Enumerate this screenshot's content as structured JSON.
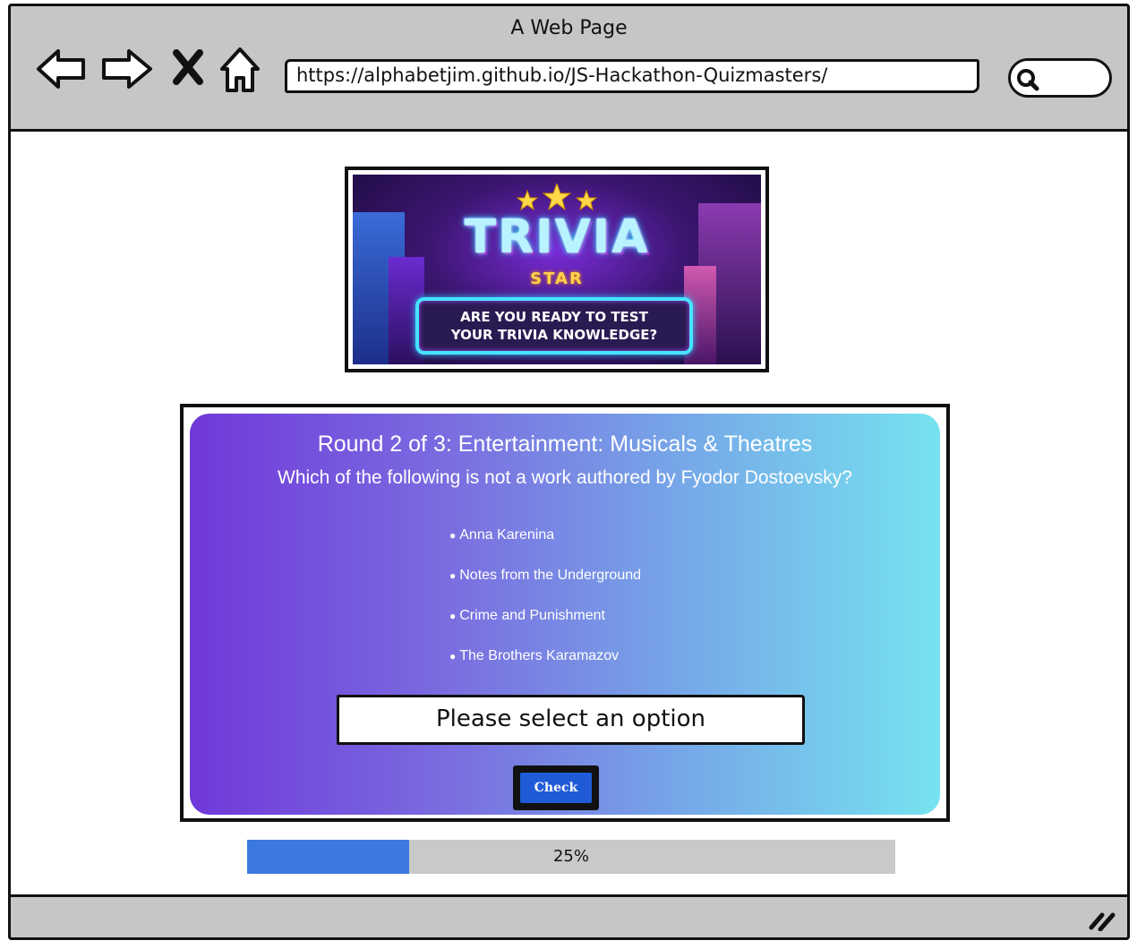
{
  "window": {
    "title": "A Web Page"
  },
  "browser": {
    "url": "https://alphabetjim.github.io/JS-Hackathon-Quizmasters/",
    "search_value": ""
  },
  "banner": {
    "title": "TRIVIA",
    "subtitle": "STAR",
    "tagline_line1": "ARE YOU READY TO TEST",
    "tagline_line2": "YOUR TRIVIA KNOWLEDGE?"
  },
  "quiz": {
    "round_title": "Round 2 of 3: Entertainment: Musicals & Theatres",
    "question": "Which of the following is not a work authored by Fyodor Dostoevsky?",
    "options": [
      "Anna Karenina",
      "Notes from the Underground",
      "Crime and Punishment",
      "The Brothers Karamazov"
    ],
    "message": "Please select an option",
    "check_label": "Check"
  },
  "progress": {
    "value": 0.25,
    "label": "25%"
  },
  "colors": {
    "card_gradient_start": "#7038d9",
    "card_gradient_end": "#76e3ef",
    "button": "#1f5bd6",
    "progress_fill": "#3b79e0",
    "chrome": "#c6c6c6"
  },
  "icons": [
    "back-arrow-icon",
    "forward-arrow-icon",
    "close-x-icon",
    "home-icon",
    "search-icon",
    "resize-handle-icon"
  ]
}
